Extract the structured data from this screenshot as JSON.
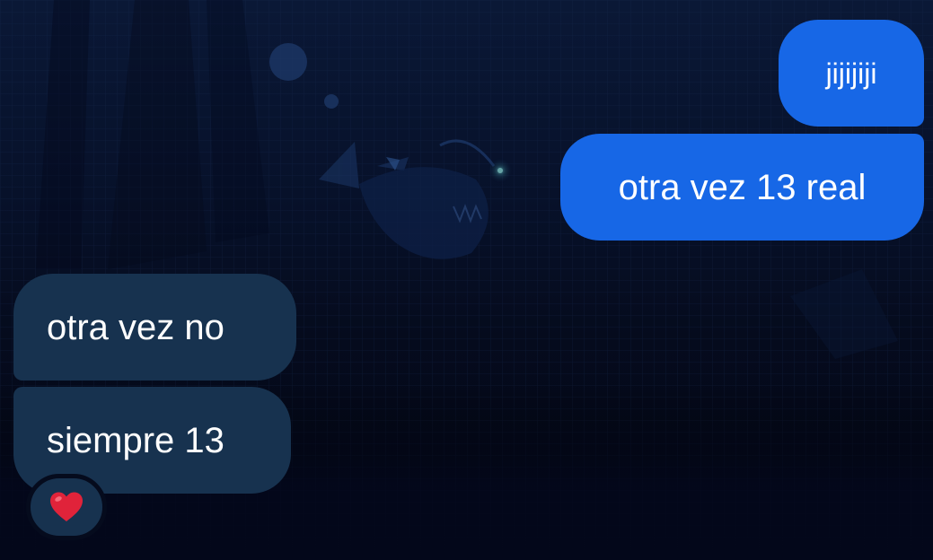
{
  "chat": {
    "messages": [
      {
        "text": "jijijiji",
        "direction": "outgoing"
      },
      {
        "text": "otra vez 13 real",
        "direction": "outgoing"
      },
      {
        "text": "otra vez no",
        "direction": "incoming"
      },
      {
        "text": "siempre 13",
        "direction": "incoming"
      }
    ],
    "reaction": {
      "icon": "heart-icon",
      "on_message": 3
    }
  },
  "colors": {
    "outgoing_bubble": "#1767e6",
    "incoming_bubble": "#17324f",
    "background_top": "#0a1836",
    "background_bottom": "#03071a",
    "heart": "#e0233a"
  }
}
